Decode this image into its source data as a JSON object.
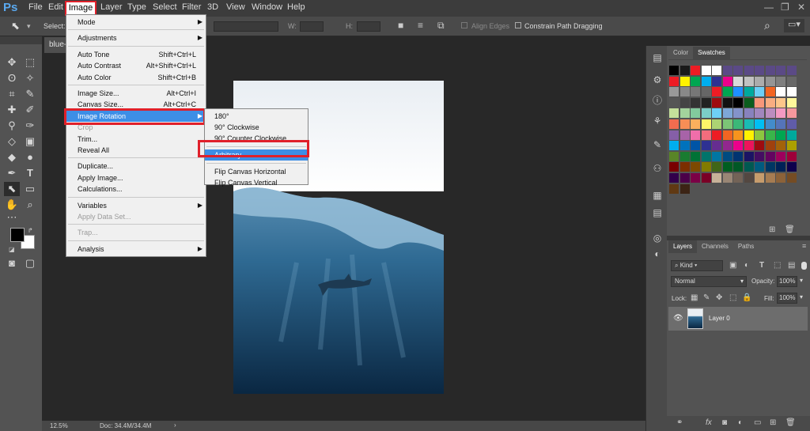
{
  "app": {
    "logo": "Ps",
    "window_controls": [
      "—",
      "❐",
      "✕"
    ]
  },
  "menubar": [
    "File",
    "Edit",
    "Image",
    "Layer",
    "Type",
    "Select",
    "Filter",
    "3D",
    "View",
    "Window",
    "Help"
  ],
  "options_bar": {
    "select_label": "Select:",
    "w_label": "W:",
    "h_label": "H:",
    "align_edges": "Align Edges",
    "constrain_path": "Constrain Path Dragging"
  },
  "document": {
    "tab_label": "blue-",
    "zoom": "12.5%",
    "doc_size": "Doc: 34.4M/34.4M"
  },
  "image_menu": [
    {
      "label": "Mode",
      "shortcut": "",
      "submenu": true,
      "disabled": false
    },
    {
      "sep": true
    },
    {
      "label": "Adjustments",
      "shortcut": "",
      "submenu": true,
      "disabled": false
    },
    {
      "sep": true
    },
    {
      "label": "Auto Tone",
      "shortcut": "Shift+Ctrl+L",
      "submenu": false,
      "disabled": false
    },
    {
      "label": "Auto Contrast",
      "shortcut": "Alt+Shift+Ctrl+L",
      "submenu": false,
      "disabled": false
    },
    {
      "label": "Auto Color",
      "shortcut": "Shift+Ctrl+B",
      "submenu": false,
      "disabled": false
    },
    {
      "sep": true
    },
    {
      "label": "Image Size...",
      "shortcut": "Alt+Ctrl+I",
      "submenu": false,
      "disabled": false
    },
    {
      "label": "Canvas Size...",
      "shortcut": "Alt+Ctrl+C",
      "submenu": false,
      "disabled": false
    },
    {
      "label": "Image Rotation",
      "shortcut": "",
      "submenu": true,
      "disabled": false,
      "highlighted": true
    },
    {
      "label": "Crop",
      "shortcut": "",
      "submenu": false,
      "disabled": true
    },
    {
      "label": "Trim...",
      "shortcut": "",
      "submenu": false,
      "disabled": false
    },
    {
      "label": "Reveal All",
      "shortcut": "",
      "submenu": false,
      "disabled": false
    },
    {
      "sep": true
    },
    {
      "label": "Duplicate...",
      "shortcut": "",
      "submenu": false,
      "disabled": false
    },
    {
      "label": "Apply Image...",
      "shortcut": "",
      "submenu": false,
      "disabled": false
    },
    {
      "label": "Calculations...",
      "shortcut": "",
      "submenu": false,
      "disabled": false
    },
    {
      "sep": true
    },
    {
      "label": "Variables",
      "shortcut": "",
      "submenu": true,
      "disabled": false
    },
    {
      "label": "Apply Data Set...",
      "shortcut": "",
      "submenu": false,
      "disabled": true
    },
    {
      "sep": true
    },
    {
      "label": "Trap...",
      "shortcut": "",
      "submenu": false,
      "disabled": true
    },
    {
      "sep": true
    },
    {
      "label": "Analysis",
      "shortcut": "",
      "submenu": true,
      "disabled": false
    }
  ],
  "rotation_submenu": [
    {
      "label": "180°"
    },
    {
      "label": "90° Clockwise"
    },
    {
      "label": "90° Counter Clockwise"
    },
    {
      "sep": true
    },
    {
      "label": "Arbitrary...",
      "highlighted": true
    },
    {
      "sep": true
    },
    {
      "label": "Flip Canvas Horizontal"
    },
    {
      "label": "Flip Canvas Vertical"
    }
  ],
  "panels": {
    "color_tabs": [
      "Color",
      "Swatches"
    ],
    "active_color_tab": "Swatches",
    "layer_tabs": [
      "Layers",
      "Channels",
      "Paths"
    ],
    "kind_label": "Kind",
    "blend_mode": "Normal",
    "opacity_label": "Opacity:",
    "opacity_value": "100%",
    "lock_label": "Lock:",
    "fill_label": "Fill:",
    "fill_value": "100%",
    "layer_name": "Layer 0",
    "bottom_icons": [
      "fx"
    ]
  },
  "swatch_colors": [
    [
      "#000000",
      "#1a1a1a",
      "#ed1c24",
      "#ffffff",
      "#ffffff",
      "#5b4a86",
      "#5b4a86",
      "#5b4a86",
      "#5b4a86",
      "#5b4a86",
      "#5b4a86",
      "#5b4a86"
    ],
    [
      "#ed1c24",
      "#fff200",
      "#00a651",
      "#00aeef",
      "#2e3192",
      "#ec008c",
      "#d9d9d9",
      "#c2c2c2",
      "#acacac",
      "#959595",
      "#7f7f7f",
      "#686868"
    ],
    [
      "#999999",
      "#888888",
      "#777777",
      "#666666",
      "#ed1c24",
      "#00a651",
      "#1e90ff",
      "#00a99d",
      "#6dcff6",
      "#f26522",
      "#ffffff",
      "#ffffff"
    ],
    [
      "#555555",
      "#444444",
      "#333333",
      "#222222",
      "#9e0b0f",
      "#111111",
      "#000000",
      "#0b5d1e",
      "#f7977a",
      "#f9ad81",
      "#fdc68a",
      "#fff79a"
    ],
    [
      "#c4df9b",
      "#a3d39c",
      "#82ca9d",
      "#7bcdc8",
      "#6ecff6",
      "#7ea7d8",
      "#8493ca",
      "#8882be",
      "#a187be",
      "#bc8dbf",
      "#f49ac2",
      "#f6989d"
    ],
    [
      "#f26c4f",
      "#f68e56",
      "#fbaf5d",
      "#fff568",
      "#acd373",
      "#7cc576",
      "#3bb878",
      "#1abbb4",
      "#00bff3",
      "#438ccb",
      "#5574b9",
      "#605ca8"
    ],
    [
      "#855fa8",
      "#a763a8",
      "#f06eaa",
      "#f26d7d",
      "#ed1c24",
      "#f26522",
      "#f7941d",
      "#fff200",
      "#8dc63f",
      "#39b54a",
      "#00a651",
      "#00a99d"
    ],
    [
      "#00aeef",
      "#0072bc",
      "#0054a6",
      "#2e3192",
      "#662d91",
      "#92278f",
      "#ec008c",
      "#ed145b",
      "#9e0b0f",
      "#a0410d",
      "#a36209",
      "#aba000"
    ],
    [
      "#598527",
      "#1a7b30",
      "#007236",
      "#00746b",
      "#0076a3",
      "#004b80",
      "#003471",
      "#1b1464",
      "#440e62",
      "#630460",
      "#9e005d",
      "#9e0039"
    ],
    [
      "#790000",
      "#7b2e00",
      "#7d4900",
      "#827b00",
      "#406618",
      "#005e20",
      "#005826",
      "#005952",
      "#005b7f",
      "#003663",
      "#002157",
      "#0d004c"
    ],
    [
      "#32004b",
      "#4b0049",
      "#7b0046",
      "#7a0026",
      "#c7b299",
      "#998675",
      "#736357",
      "#534741",
      "#c69c6d",
      "#a67c52",
      "#8c6239",
      "#754c24"
    ],
    [
      "#603913",
      "#3c2415"
    ]
  ]
}
